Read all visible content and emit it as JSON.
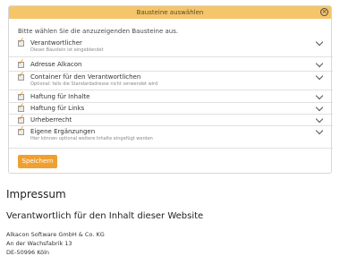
{
  "dialog": {
    "title": "Bausteine auswählen",
    "close_icon": "×",
    "intro": "Bitte wählen Sie die anzuzeigenden Bausteine aus.",
    "items": [
      {
        "label": "Verantwortlicher",
        "desc": "Dieser Baustein ist eingeblendet",
        "checked": true
      },
      {
        "label": "Adresse Alkacon",
        "desc": "",
        "checked": true
      },
      {
        "label": "Container für den Verantwortlichen",
        "desc": "Optional: falls die Standardadresse nicht verwendet wird",
        "checked": true
      },
      {
        "label": "Haftung für Inhalte",
        "desc": "",
        "checked": true
      },
      {
        "label": "Haftung für Links",
        "desc": "",
        "checked": true
      },
      {
        "label": "Urheberrecht",
        "desc": "",
        "checked": true
      },
      {
        "label": "Eigene Ergänzungen",
        "desc": "Hier können optional weitere Inhalte eingefügt werden",
        "checked": true
      }
    ],
    "save_label": "Speichern"
  },
  "page": {
    "title": "Impressum",
    "subtitle": "Verantwortlich für den Inhalt dieser Website",
    "address": [
      "Alkacon Software GmbH & Co. KG",
      "An der Wachsfabrik 13",
      "DE-50996 Köln"
    ]
  }
}
